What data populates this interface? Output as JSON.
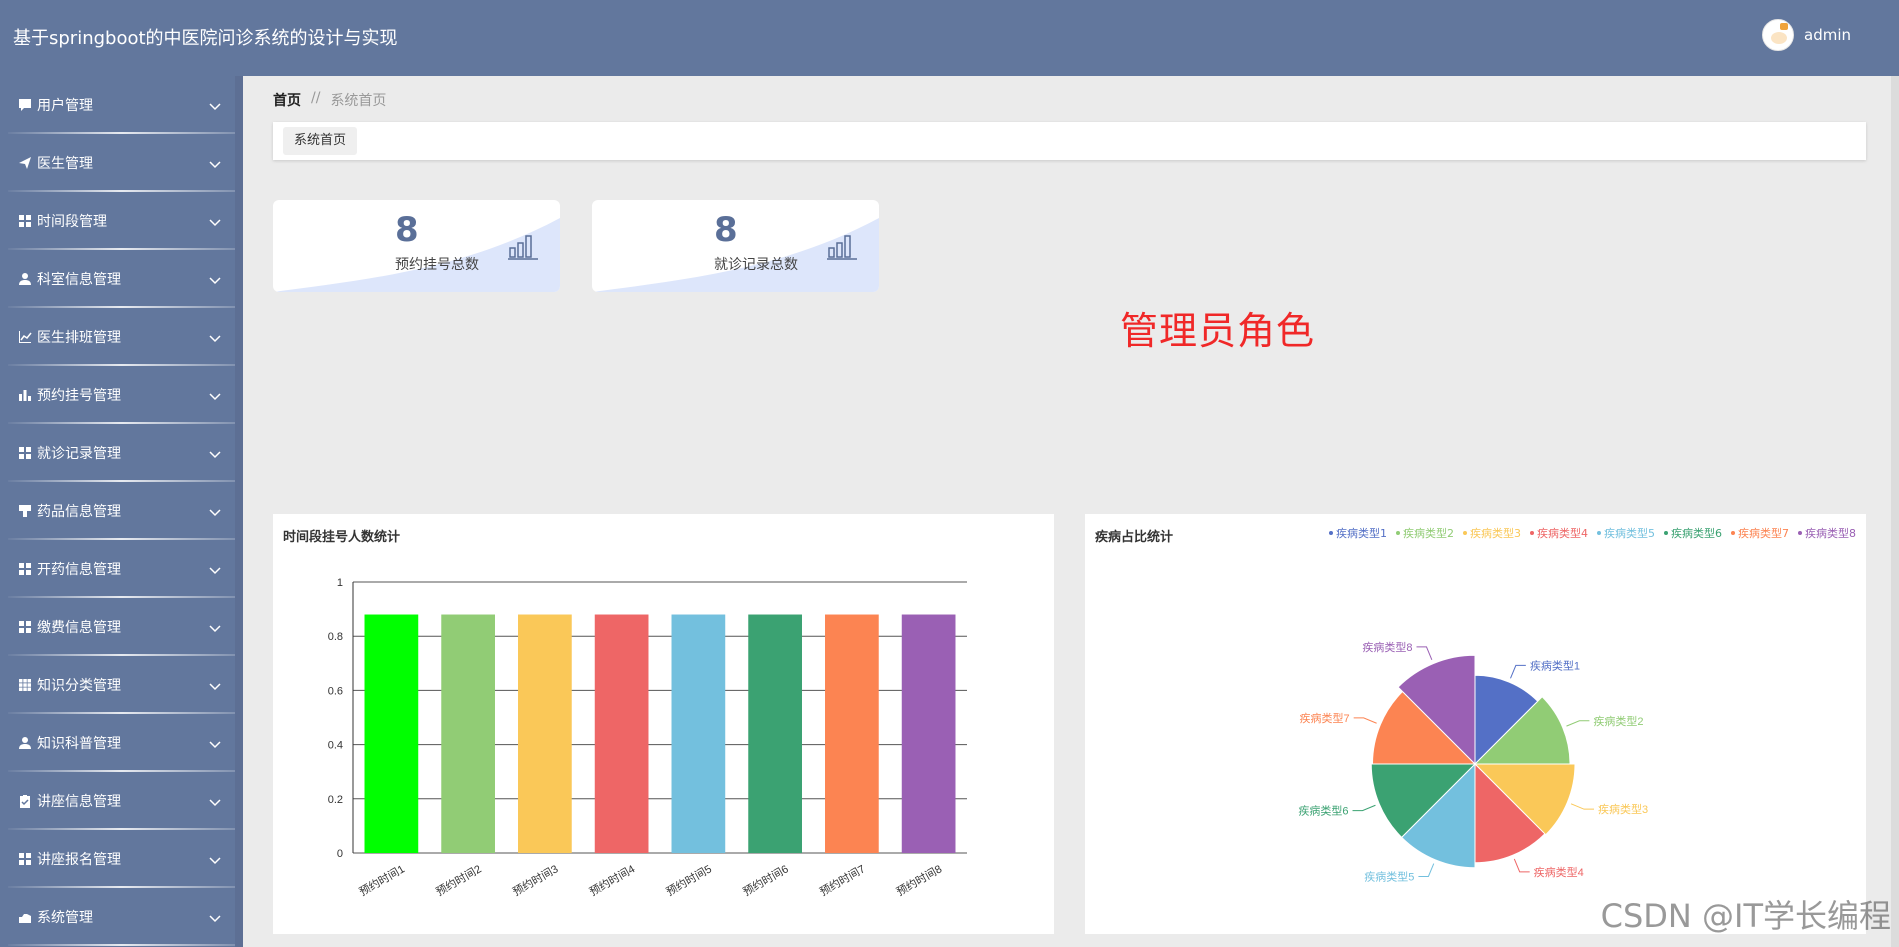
{
  "header": {
    "title": "基于springboot的中医院问诊系统的设计与实现",
    "user": "admin"
  },
  "sidebar": {
    "items": [
      {
        "label": "用户管理",
        "icon": "chat-icon"
      },
      {
        "label": "医生管理",
        "icon": "send-icon"
      },
      {
        "label": "时间段管理",
        "icon": "grid-icon"
      },
      {
        "label": "科室信息管理",
        "icon": "person-icon"
      },
      {
        "label": "医生排班管理",
        "icon": "line-chart-icon"
      },
      {
        "label": "预约挂号管理",
        "icon": "bar-chart-icon"
      },
      {
        "label": "就诊记录管理",
        "icon": "grid-icon"
      },
      {
        "label": "药品信息管理",
        "icon": "brush-icon"
      },
      {
        "label": "开药信息管理",
        "icon": "grid-icon"
      },
      {
        "label": "缴费信息管理",
        "icon": "grid-icon"
      },
      {
        "label": "知识分类管理",
        "icon": "table-icon"
      },
      {
        "label": "知识科普管理",
        "icon": "person-icon"
      },
      {
        "label": "讲座信息管理",
        "icon": "clipboard-icon"
      },
      {
        "label": "讲座报名管理",
        "icon": "grid-icon"
      },
      {
        "label": "系统管理",
        "icon": "settings-icon"
      }
    ]
  },
  "breadcrumb": {
    "home": "首页",
    "separator": "//",
    "current": "系统首页"
  },
  "tabs": [
    {
      "label": "系统首页"
    }
  ],
  "stats": [
    {
      "value": "8",
      "label": "预约挂号总数"
    },
    {
      "value": "8",
      "label": "就诊记录总数"
    }
  ],
  "role_text": "管理员角色",
  "colors": {
    "header": "#62779d",
    "accent": "#5a6f98",
    "role": "#f02828"
  },
  "chart_data": [
    {
      "type": "bar",
      "title": "时间段挂号人数统计",
      "categories": [
        "预约时间1",
        "预约时间2",
        "预约时间3",
        "预约时间4",
        "预约时间5",
        "预约时间6",
        "预约时间7",
        "预约时间8"
      ],
      "values": [
        0.88,
        0.88,
        0.88,
        0.88,
        0.88,
        0.88,
        0.88,
        0.88
      ],
      "colors": [
        "#00ff00",
        "#91cc75",
        "#fac858",
        "#ee6666",
        "#73c0de",
        "#3ba272",
        "#fc8452",
        "#9a60b4"
      ],
      "ylim": [
        0,
        1
      ],
      "yticks": [
        "0",
        "0.2",
        "0.4",
        "0.6",
        "0.8",
        "1"
      ],
      "grid": true
    },
    {
      "type": "pie",
      "title": "疾病占比统计",
      "labels": [
        "疾病类型1",
        "疾病类型2",
        "疾病类型3",
        "疾病类型4",
        "疾病类型5",
        "疾病类型6",
        "疾病类型7",
        "疾病类型8"
      ],
      "radii": [
        0.71,
        0.76,
        0.8,
        0.79,
        0.83,
        0.83,
        0.82,
        0.87
      ],
      "colors": [
        "#5470c6",
        "#91cc75",
        "#fac858",
        "#ee6666",
        "#73c0de",
        "#3ba272",
        "#fc8452",
        "#9a60b4"
      ],
      "legend": "top-right"
    }
  ],
  "watermark": "CSDN @IT学长编程"
}
